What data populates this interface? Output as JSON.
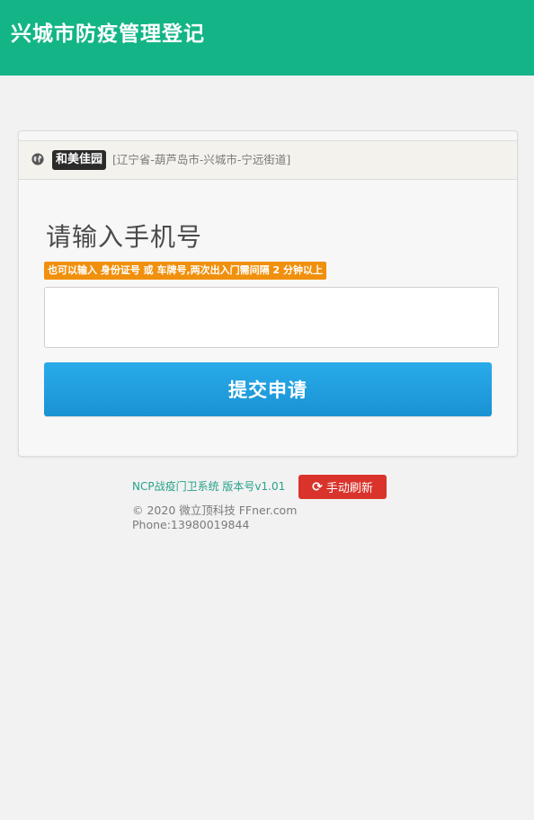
{
  "header": {
    "title": "兴城市防疫管理登记"
  },
  "site": {
    "icon": "globe-icon",
    "name": "和美佳园",
    "location": "[辽宁省-葫芦岛市-兴城市-宁远街道]"
  },
  "form": {
    "title": "请输入手机号",
    "hint": "也可以输入 身份证号 或 车牌号,两次出入门需间隔 2 分钟以上",
    "input_value": "",
    "input_placeholder": "",
    "submit_label": "提交申请"
  },
  "footer": {
    "version": "NCP战疫门卫系统 版本号v1.01",
    "refresh_icon": "refresh-icon",
    "refresh_label": "手动刷新",
    "copyright": "© 2020 微立顶科技 FFner.com",
    "phone": "Phone:13980019844"
  },
  "colors": {
    "header_bg": "#13b586",
    "submit_bg": "#1e9fde",
    "hint_bg": "#f0900d",
    "refresh_bg": "#d9332b",
    "version_text": "#27a28a"
  }
}
